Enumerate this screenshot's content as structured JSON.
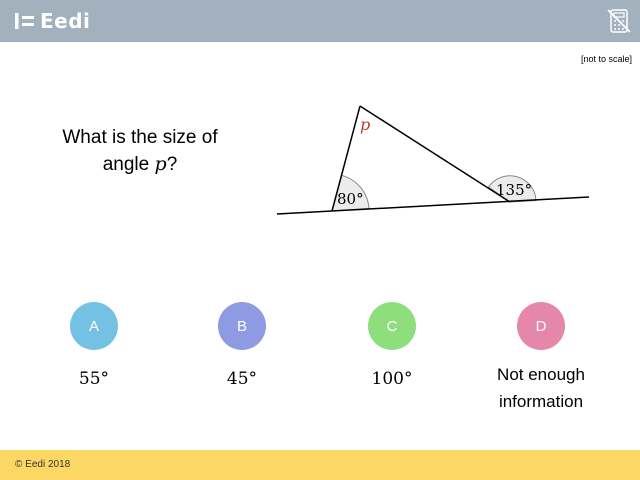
{
  "header": {
    "brand": "Eedi",
    "logo_icon": "eedi-logo-icon",
    "tool_icon": "calculator-crossed-icon"
  },
  "note": "[not to scale]",
  "question": {
    "text_before": "What is the size of angle ",
    "variable": "p",
    "text_after": "?"
  },
  "diagram": {
    "apex_label": "p",
    "angle_left": "80°",
    "angle_right": "135°",
    "apex_label_color": "#c0392b"
  },
  "options": [
    {
      "letter": "A",
      "answer": "55°",
      "color": "#75c1e3"
    },
    {
      "letter": "B",
      "answer": "45°",
      "color": "#8e9be3"
    },
    {
      "letter": "C",
      "answer": "100°",
      "color": "#8ede7e"
    },
    {
      "letter": "D",
      "answer": "Not enough information",
      "color": "#e587a8"
    }
  ],
  "footer": {
    "copyright": "© Eedi 2018"
  }
}
